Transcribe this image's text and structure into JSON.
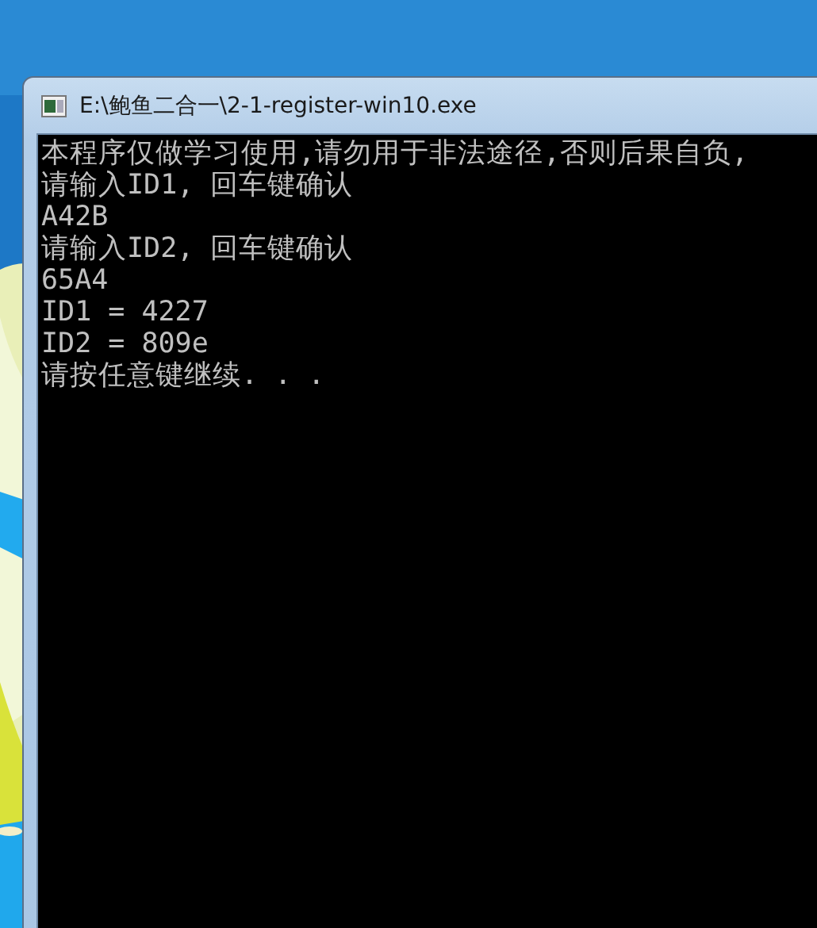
{
  "window": {
    "title": "E:\\鲍鱼二合一\\2-1-register-win10.exe"
  },
  "console_lines": [
    {
      "text": "本程序仅做学习使用,请勿用于非法途径,否则后果自负,"
    },
    {
      "text": "请输入ID1, 回车键确认"
    },
    {
      "text": "A42B"
    },
    {
      "text": "请输入ID2, 回车键确认"
    },
    {
      "text": "65A4"
    },
    {
      "text": "ID1 = 4227"
    },
    {
      "text": "ID2 = 809e"
    },
    {
      "text": "请按任意键继续. . ."
    }
  ]
}
